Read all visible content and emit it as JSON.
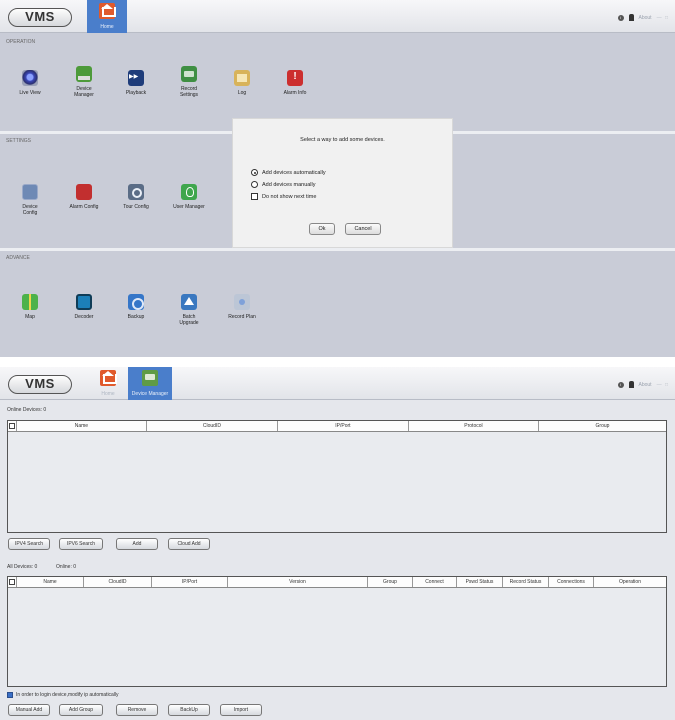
{
  "colors": {
    "accent": "#4a7ecb",
    "home_icon": "#e05a2c",
    "panel_bg": "#c9ccd7"
  },
  "screen1": {
    "logo": "VMS",
    "tab_home": "Home",
    "about": "About",
    "window_controls": "— □",
    "sections": {
      "operation": "OPERATION",
      "settings": "SETTINGS",
      "advance": "ADVANCE"
    },
    "operation_items": [
      {
        "label": "Live View",
        "icon": "live-view-icon"
      },
      {
        "label": "Device\nManager",
        "icon": "device-manager-icon"
      },
      {
        "label": "Playback",
        "icon": "playback-icon"
      },
      {
        "label": "Record\nSettings",
        "icon": "record-settings-icon"
      },
      {
        "label": "Log",
        "icon": "log-icon"
      },
      {
        "label": "Alarm Info",
        "icon": "alarm-info-icon"
      }
    ],
    "settings_items": [
      {
        "label": "Device\nConfig",
        "icon": "device-config-icon"
      },
      {
        "label": "Alarm Config",
        "icon": "alarm-config-icon"
      },
      {
        "label": "Tour Config",
        "icon": "tour-config-icon"
      },
      {
        "label": "User Manager",
        "icon": "user-manager-icon"
      }
    ],
    "advance_items": [
      {
        "label": "Map",
        "icon": "map-icon"
      },
      {
        "label": "Decoder",
        "icon": "decoder-icon"
      },
      {
        "label": "Backup",
        "icon": "backup-icon"
      },
      {
        "label": "Batch\nUpgrade",
        "icon": "batch-upgrade-icon"
      },
      {
        "label": "Record Plan",
        "icon": "record-plan-icon"
      }
    ],
    "dialog": {
      "title": "Select a way to add some devices.",
      "option_auto": "Add devices automatically",
      "option_manual": "Add devices manually",
      "do_not_show": "Do not show next time",
      "selected": "auto",
      "ok": "Ok",
      "cancel": "Cancel"
    }
  },
  "screen2": {
    "logo": "VMS",
    "tab_home": "Home",
    "tab_device_manager": "Device Manager",
    "about": "About",
    "window_controls": "— □",
    "online_devices": "Online Devices:  0",
    "online_columns": [
      "Name",
      "CloudID",
      "IP/Port",
      "Protocol",
      "Group"
    ],
    "search_buttons": [
      "IPV4 Search",
      "IPV6 Search",
      "Add",
      "Cloud Add"
    ],
    "all_devices": "All Devices:  0",
    "online_count": "Online:  0",
    "all_columns": [
      "Name",
      "CloudID",
      "IP/Port",
      "Version",
      "Group",
      "Connect",
      "Pswd Status",
      "Record Status",
      "Connections",
      "Operation"
    ],
    "auto_ip_text": "In order to login device,modify ip automatically",
    "bottom_buttons": [
      "Manual Add",
      "Add Group",
      "Remove",
      "BackUp",
      "Import"
    ]
  }
}
